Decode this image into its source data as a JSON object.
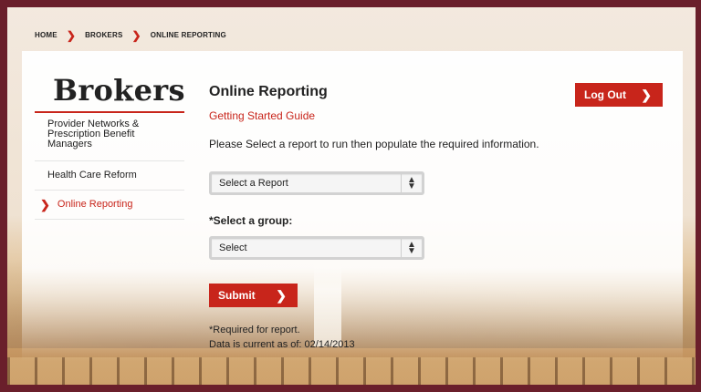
{
  "breadcrumb": {
    "items": [
      "HOME",
      "BROKERS",
      "ONLINE REPORTING"
    ]
  },
  "sidebar": {
    "title": "Brokers",
    "items": [
      {
        "label": "Provider Networks & Prescription Benefit Managers"
      },
      {
        "label": "Health Care Reform"
      },
      {
        "label": "Online Reporting",
        "active": true
      }
    ]
  },
  "main": {
    "title": "Online Reporting",
    "guide_link": "Getting Started Guide",
    "description": "Please Select a report to run then populate the required information.",
    "report_select": {
      "selected": "Select a Report"
    },
    "group_label": "*Select a group:",
    "group_select": {
      "selected": "Select"
    },
    "submit_label": "Submit",
    "required_note": "*Required for report.",
    "data_current": "Data is current as of: 02/14/2013"
  },
  "header": {
    "logout_label": "Log Out"
  },
  "colors": {
    "accent": "#c8251b",
    "frame": "#6a1f2b",
    "text": "#222222"
  },
  "icons": {
    "breadcrumb_separator": "chevron-right-icon",
    "button_chevron": "chevron-right-icon",
    "select_arrows": "select-updown-icon"
  }
}
